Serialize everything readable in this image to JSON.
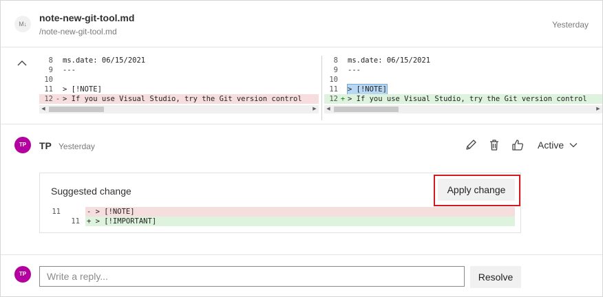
{
  "file": {
    "badge": "M↓",
    "name": "note-new-git-tool.md",
    "path": "/note-new-git-tool.md",
    "time": "Yesterday"
  },
  "diff": {
    "left": [
      {
        "ln": "8",
        "marker": " ",
        "text": "ms.date: 06/15/2021",
        "type": "context"
      },
      {
        "ln": "9",
        "marker": " ",
        "text": "---",
        "type": "context"
      },
      {
        "ln": "10",
        "marker": " ",
        "text": "",
        "type": "context"
      },
      {
        "ln": "11",
        "marker": " ",
        "text": "> [!NOTE]",
        "type": "context"
      },
      {
        "ln": "12",
        "marker": "-",
        "text": "> If you use Visual Studio, try the Git version control",
        "type": "removed"
      }
    ],
    "right": [
      {
        "ln": "8",
        "marker": " ",
        "text": "ms.date: 06/15/2021",
        "type": "context"
      },
      {
        "ln": "9",
        "marker": " ",
        "text": "---",
        "type": "context"
      },
      {
        "ln": "10",
        "marker": " ",
        "text": "",
        "type": "context"
      },
      {
        "ln": "11",
        "marker": " ",
        "text": "> [!NOTE]",
        "type": "context",
        "selected": true
      },
      {
        "ln": "12",
        "marker": "+",
        "text": "> If you use Visual Studio, try the Git version control",
        "type": "added"
      }
    ]
  },
  "comment": {
    "avatar": "TP",
    "author": "TP",
    "time": "Yesterday",
    "status": "Active",
    "suggestion": {
      "title": "Suggested change",
      "apply_label": "Apply change",
      "lines": [
        {
          "old_ln": "11",
          "new_ln": "",
          "text": "- > [!NOTE]",
          "type": "removed"
        },
        {
          "old_ln": "",
          "new_ln": "11",
          "text": "+ > [!IMPORTANT]",
          "type": "added"
        }
      ]
    }
  },
  "reply": {
    "avatar": "TP",
    "placeholder": "Write a reply...",
    "resolve_label": "Resolve"
  },
  "colors": {
    "avatar": "#b4009e",
    "removed": "#f7dede",
    "added": "#def3de",
    "highlight_box": "#d1191f"
  }
}
